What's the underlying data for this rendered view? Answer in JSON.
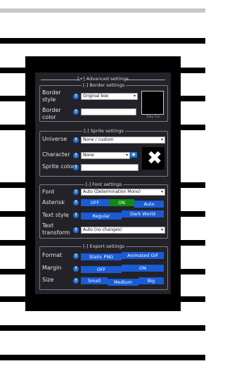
{
  "advanced": {
    "title": "[+] Advanced settings"
  },
  "border": {
    "legend": "[-] Border settings",
    "style_label": "Border style",
    "style_value": "Original box",
    "color_label": "Border color",
    "tobyfox_caption": "Toby Fox"
  },
  "sprite": {
    "legend": "[-] Sprite settings",
    "universe_label": "Universe",
    "universe_value": "None / custom",
    "character_label": "Character",
    "character_value": "None",
    "sprite_color_label": "Sprite color"
  },
  "font": {
    "legend": "[-] Font settings",
    "font_label": "Font",
    "font_value": "Auto (Determination Mono)",
    "asterisk_label": "Asterisk",
    "asterisk_options": [
      "OFF",
      "ON",
      "Auto"
    ],
    "textstyle_label": "Text style",
    "textstyle_options": [
      "Regular",
      "Dark World"
    ],
    "transform_label": "Text transform",
    "transform_value": "Auto (no changes)"
  },
  "export": {
    "legend": "[-] Export settings",
    "format_label": "Format",
    "format_options": [
      "Static PNG",
      "Animated GIF"
    ],
    "margin_label": "Margin",
    "margin_options": [
      "OFF",
      "ON"
    ],
    "size_label": "Size",
    "size_options": [
      "Small",
      "Medium",
      "Big"
    ]
  },
  "help_glyph": "?",
  "colors": {
    "panel": "#222228",
    "accent": "#1a5bd6",
    "active": "#108a10"
  },
  "icons": [
    "help-icon",
    "chevron-down-icon",
    "eye-icon",
    "close-icon"
  ]
}
